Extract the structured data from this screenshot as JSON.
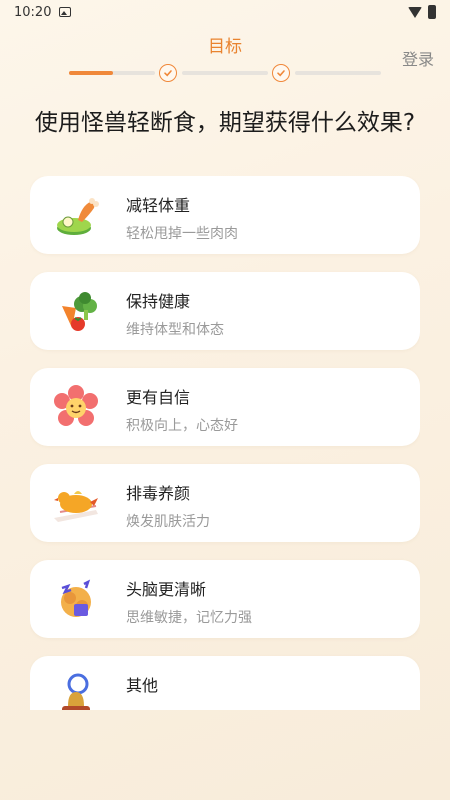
{
  "status_bar": {
    "time": "10:20"
  },
  "header": {
    "title": "目标",
    "login_label": "登录",
    "progress": 0.33
  },
  "question": "使用怪兽轻断食，期望获得什么效果?",
  "options": [
    {
      "title": "减轻体重",
      "subtitle": "轻松甩掉一些肉肉",
      "icon": "drumstick-scale-icon"
    },
    {
      "title": "保持健康",
      "subtitle": "维持体型和体态",
      "icon": "vegetables-icon"
    },
    {
      "title": "更有自信",
      "subtitle": "积极向上，心态好",
      "icon": "smiling-flower-icon"
    },
    {
      "title": "排毒养颜",
      "subtitle": "焕发肌肤活力",
      "icon": "relaxing-chicken-icon"
    },
    {
      "title": "头脑更清晰",
      "subtitle": "思维敏捷，记忆力强",
      "icon": "brain-bolt-icon"
    },
    {
      "title": "其他",
      "subtitle": "",
      "icon": "bell-icon"
    }
  ],
  "colors": {
    "accent": "#f0883a",
    "title_accent": "#e9832f",
    "background": "#fbf1e2"
  }
}
